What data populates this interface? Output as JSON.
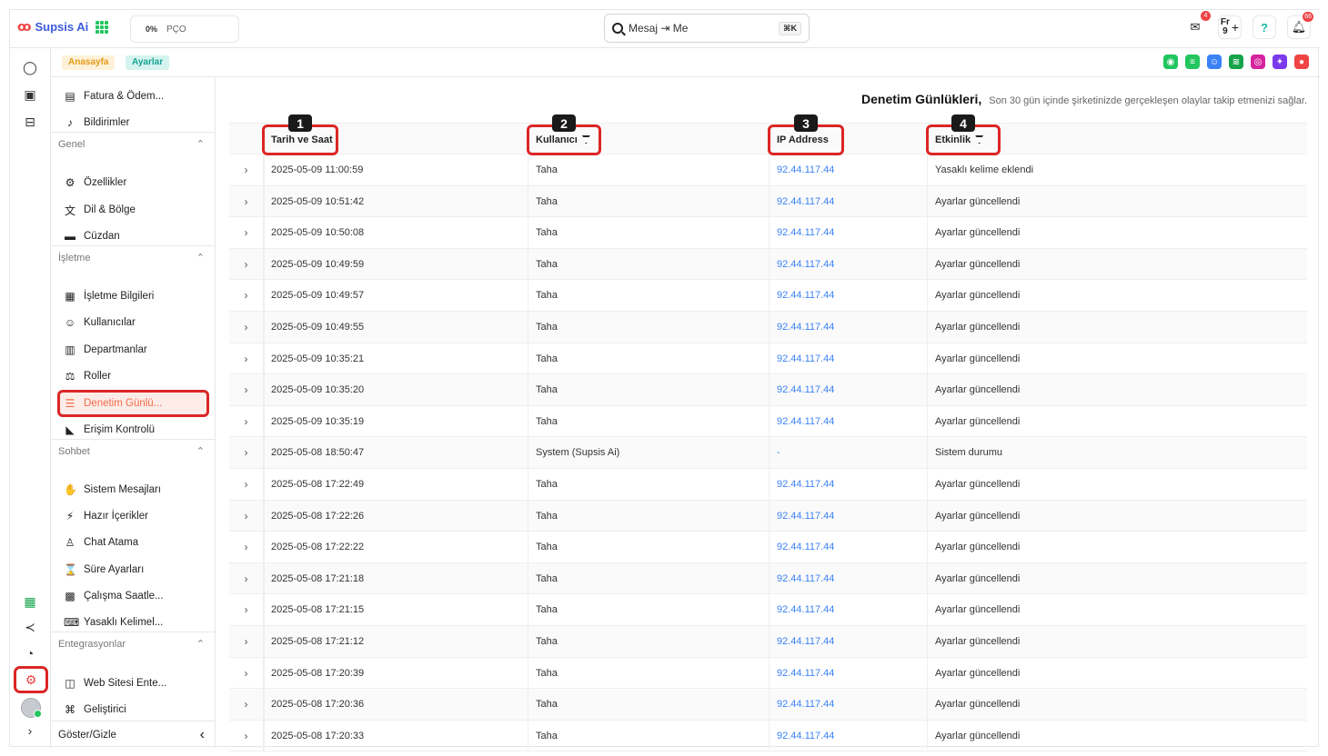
{
  "app": {
    "name": "Supsis Ai"
  },
  "topbar": {
    "pco_value": "0%",
    "pco_label": "PÇO",
    "search_value": "Mesaj ⇥ Me",
    "search_shortcut": "⌘K",
    "mail_badge": "4",
    "lang_top": "Fr",
    "lang_bottom": "9",
    "help_icon": "?",
    "notif_badge": "66"
  },
  "breadcrumb": {
    "home": "Anasayfa",
    "current": "Ayarlar"
  },
  "channels": [
    {
      "name": "bot-icon",
      "color": "#22c55e",
      "glyph": "◉"
    },
    {
      "name": "list-icon",
      "color": "#22c55e",
      "glyph": "≡"
    },
    {
      "name": "users-icon",
      "color": "#3b82f6",
      "glyph": "☺"
    },
    {
      "name": "wifi-icon",
      "color": "#16a34a",
      "glyph": "≋"
    },
    {
      "name": "instagram-icon",
      "color": "#d6249f",
      "glyph": "◎"
    },
    {
      "name": "messenger-icon",
      "color": "#7c3aed",
      "glyph": "✦"
    },
    {
      "name": "other-channel-icon",
      "color": "#ef4444",
      "glyph": "●"
    }
  ],
  "sidebar": {
    "top_items": [
      {
        "label": "Fatura & Ödem...",
        "icon": "billing-icon"
      },
      {
        "label": "Bildirimler",
        "icon": "bell-icon"
      }
    ],
    "sections": [
      {
        "title": "Genel",
        "items": [
          {
            "label": "Özellikler",
            "icon": "gear-icon"
          },
          {
            "label": "Dil & Bölge",
            "icon": "translate-icon"
          },
          {
            "label": "Cüzdan",
            "icon": "wallet-icon"
          }
        ]
      },
      {
        "title": "İşletme",
        "items": [
          {
            "label": "İşletme Bilgileri",
            "icon": "building-icon"
          },
          {
            "label": "Kullanıcılar",
            "icon": "users-icon"
          },
          {
            "label": "Departmanlar",
            "icon": "departments-icon"
          },
          {
            "label": "Roller",
            "icon": "roles-icon"
          },
          {
            "label": "Denetim Günlü...",
            "icon": "audit-list-icon"
          },
          {
            "label": "Erişim Kontrolü",
            "icon": "access-control-icon"
          }
        ]
      },
      {
        "title": "Sohbet",
        "items": [
          {
            "label": "Sistem Mesajları",
            "icon": "system-messages-icon"
          },
          {
            "label": "Hazır İçerikler",
            "icon": "bolt-icon"
          },
          {
            "label": "Chat Atama",
            "icon": "assign-icon"
          },
          {
            "label": "Süre Ayarları",
            "icon": "hourglass-icon"
          },
          {
            "label": "Çalışma Saatle...",
            "icon": "calendar-icon"
          },
          {
            "label": "Yasaklı Kelimel...",
            "icon": "keyboard-icon"
          }
        ]
      },
      {
        "title": "Entegrasyonlar",
        "items": [
          {
            "label": "Web Sitesi Ente...",
            "icon": "web-embed-icon"
          },
          {
            "label": "Geliştirici",
            "icon": "developer-icon"
          }
        ]
      }
    ],
    "footer_label": "Göster/Gizle"
  },
  "page": {
    "title": "Denetim Günlükleri,",
    "subtitle": "Son 30 gün içinde şirketinizde gerçekleşen olaylar takip etmenizi sağlar."
  },
  "table": {
    "columns": [
      {
        "label": "Tarih ve Saat",
        "marker": "1",
        "filter": false
      },
      {
        "label": "Kullanıcı",
        "marker": "2",
        "filter": true
      },
      {
        "label": "IP Address",
        "marker": "3",
        "filter": false
      },
      {
        "label": "Etkinlik",
        "marker": "4",
        "filter": true
      }
    ],
    "rows": [
      [
        "2025-05-09 11:00:59",
        "Taha",
        "92.44.117.44",
        "Yasaklı kelime eklendi"
      ],
      [
        "2025-05-09 10:51:42",
        "Taha",
        "92.44.117.44",
        "Ayarlar güncellendi"
      ],
      [
        "2025-05-09 10:50:08",
        "Taha",
        "92.44.117.44",
        "Ayarlar güncellendi"
      ],
      [
        "2025-05-09 10:49:59",
        "Taha",
        "92.44.117.44",
        "Ayarlar güncellendi"
      ],
      [
        "2025-05-09 10:49:57",
        "Taha",
        "92.44.117.44",
        "Ayarlar güncellendi"
      ],
      [
        "2025-05-09 10:49:55",
        "Taha",
        "92.44.117.44",
        "Ayarlar güncellendi"
      ],
      [
        "2025-05-09 10:35:21",
        "Taha",
        "92.44.117.44",
        "Ayarlar güncellendi"
      ],
      [
        "2025-05-09 10:35:20",
        "Taha",
        "92.44.117.44",
        "Ayarlar güncellendi"
      ],
      [
        "2025-05-09 10:35:19",
        "Taha",
        "92.44.117.44",
        "Ayarlar güncellendi"
      ],
      [
        "2025-05-08 18:50:47",
        "System (Supsis Ai)",
        "-",
        "Sistem durumu"
      ],
      [
        "2025-05-08 17:22:49",
        "Taha",
        "92.44.117.44",
        "Ayarlar güncellendi"
      ],
      [
        "2025-05-08 17:22:26",
        "Taha",
        "92.44.117.44",
        "Ayarlar güncellendi"
      ],
      [
        "2025-05-08 17:22:22",
        "Taha",
        "92.44.117.44",
        "Ayarlar güncellendi"
      ],
      [
        "2025-05-08 17:21:18",
        "Taha",
        "92.44.117.44",
        "Ayarlar güncellendi"
      ],
      [
        "2025-05-08 17:21:15",
        "Taha",
        "92.44.117.44",
        "Ayarlar güncellendi"
      ],
      [
        "2025-05-08 17:21:12",
        "Taha",
        "92.44.117.44",
        "Ayarlar güncellendi"
      ],
      [
        "2025-05-08 17:20:39",
        "Taha",
        "92.44.117.44",
        "Ayarlar güncellendi"
      ],
      [
        "2025-05-08 17:20:36",
        "Taha",
        "92.44.117.44",
        "Ayarlar güncellendi"
      ],
      [
        "2025-05-08 17:20:33",
        "Taha",
        "92.44.117.44",
        "Ayarlar güncellendi"
      ]
    ]
  },
  "colors": {
    "accent": "#3b5bdb",
    "highlight": "#dc2626",
    "active_item": "#f06b4a",
    "link": "#3b82f6"
  }
}
